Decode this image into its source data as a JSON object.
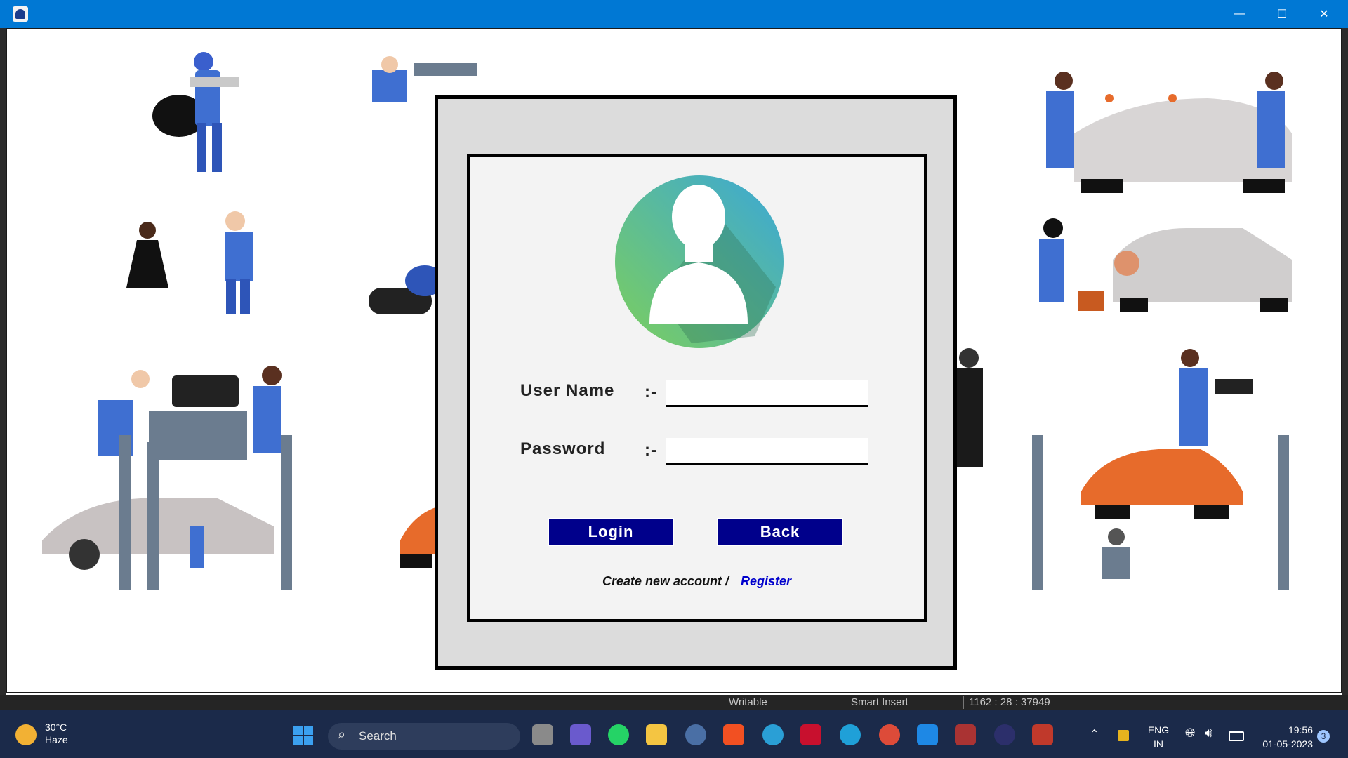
{
  "window": {
    "minimize_icon": "minimize-icon",
    "maximize_icon": "maximize-icon",
    "close_icon": "close-icon",
    "min_glyph": "—",
    "max_glyph": "☐",
    "close_glyph": "✕"
  },
  "login": {
    "username_label": "User Name",
    "username_sep": ":-",
    "username_value": "",
    "password_label": "Password",
    "password_sep": ":-",
    "password_value": "",
    "login_button": "Login",
    "back_button": "Back",
    "create_account_text": "Create new account /",
    "register_link": "Register"
  },
  "statusbar": {
    "mode": "Writable",
    "insert_mode": "Smart Insert",
    "position": "1162 : 28 : 37949"
  },
  "taskbar": {
    "weather_temp": "30°C",
    "weather_desc": "Haze",
    "search_placeholder": "Search",
    "language": "ENG",
    "region": "IN",
    "time": "19:56",
    "date": "01-05-2023",
    "notification_count": "3"
  },
  "colors": {
    "titlebar": "#0078d4",
    "button_bg": "#00008b",
    "register_link": "#0000cc",
    "taskbar": "#1b2a4a"
  }
}
